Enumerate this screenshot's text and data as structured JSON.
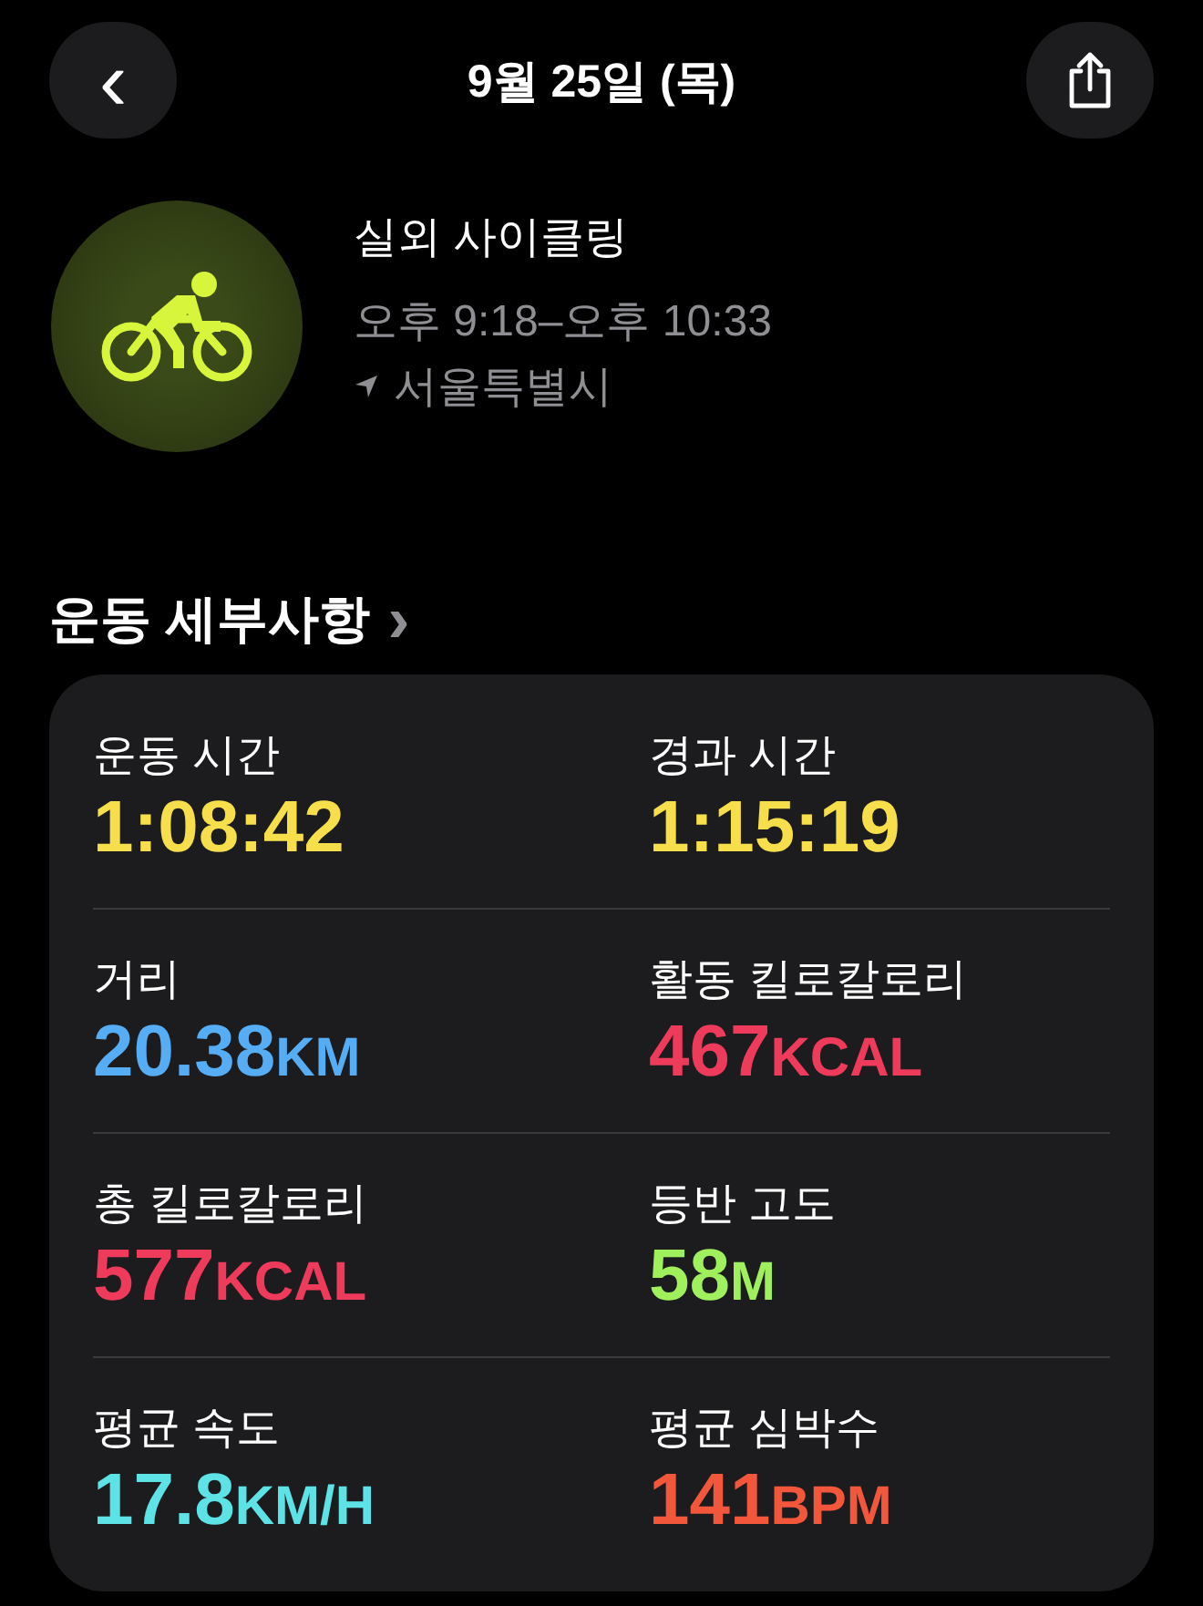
{
  "header": {
    "back": "‹",
    "title": "9월 25일 (목)"
  },
  "workout": {
    "title": "실외 사이클링",
    "time": "오후 9:18–오후 10:33",
    "location": "서울특별시"
  },
  "section": {
    "title": "운동 세부사항",
    "chevron": "›"
  },
  "metrics": [
    {
      "label": "운동 시간",
      "value": "1:08:42",
      "color": "#f7df4b"
    },
    {
      "label": "경과 시간",
      "value": "1:15:19",
      "color": "#f7df4b"
    },
    {
      "label": "거리",
      "value": "20.38",
      "unit": "KM",
      "color": "#56adf4"
    },
    {
      "label": "활동 킬로칼로리",
      "value": "467",
      "unit": "KCAL",
      "color": "#ee3b5b"
    },
    {
      "label": "총 킬로칼로리",
      "value": "577",
      "unit": "KCAL",
      "color": "#ee3b5b"
    },
    {
      "label": "등반 고도",
      "value": "58",
      "unit": "M",
      "color": "#9ff05c"
    },
    {
      "label": "평균 속도",
      "value": "17.8",
      "unit": "KM/H",
      "color": "#5de2e6"
    },
    {
      "label": "평균 심박수",
      "value": "141",
      "unit": "BPM",
      "color": "#f2563b"
    }
  ]
}
